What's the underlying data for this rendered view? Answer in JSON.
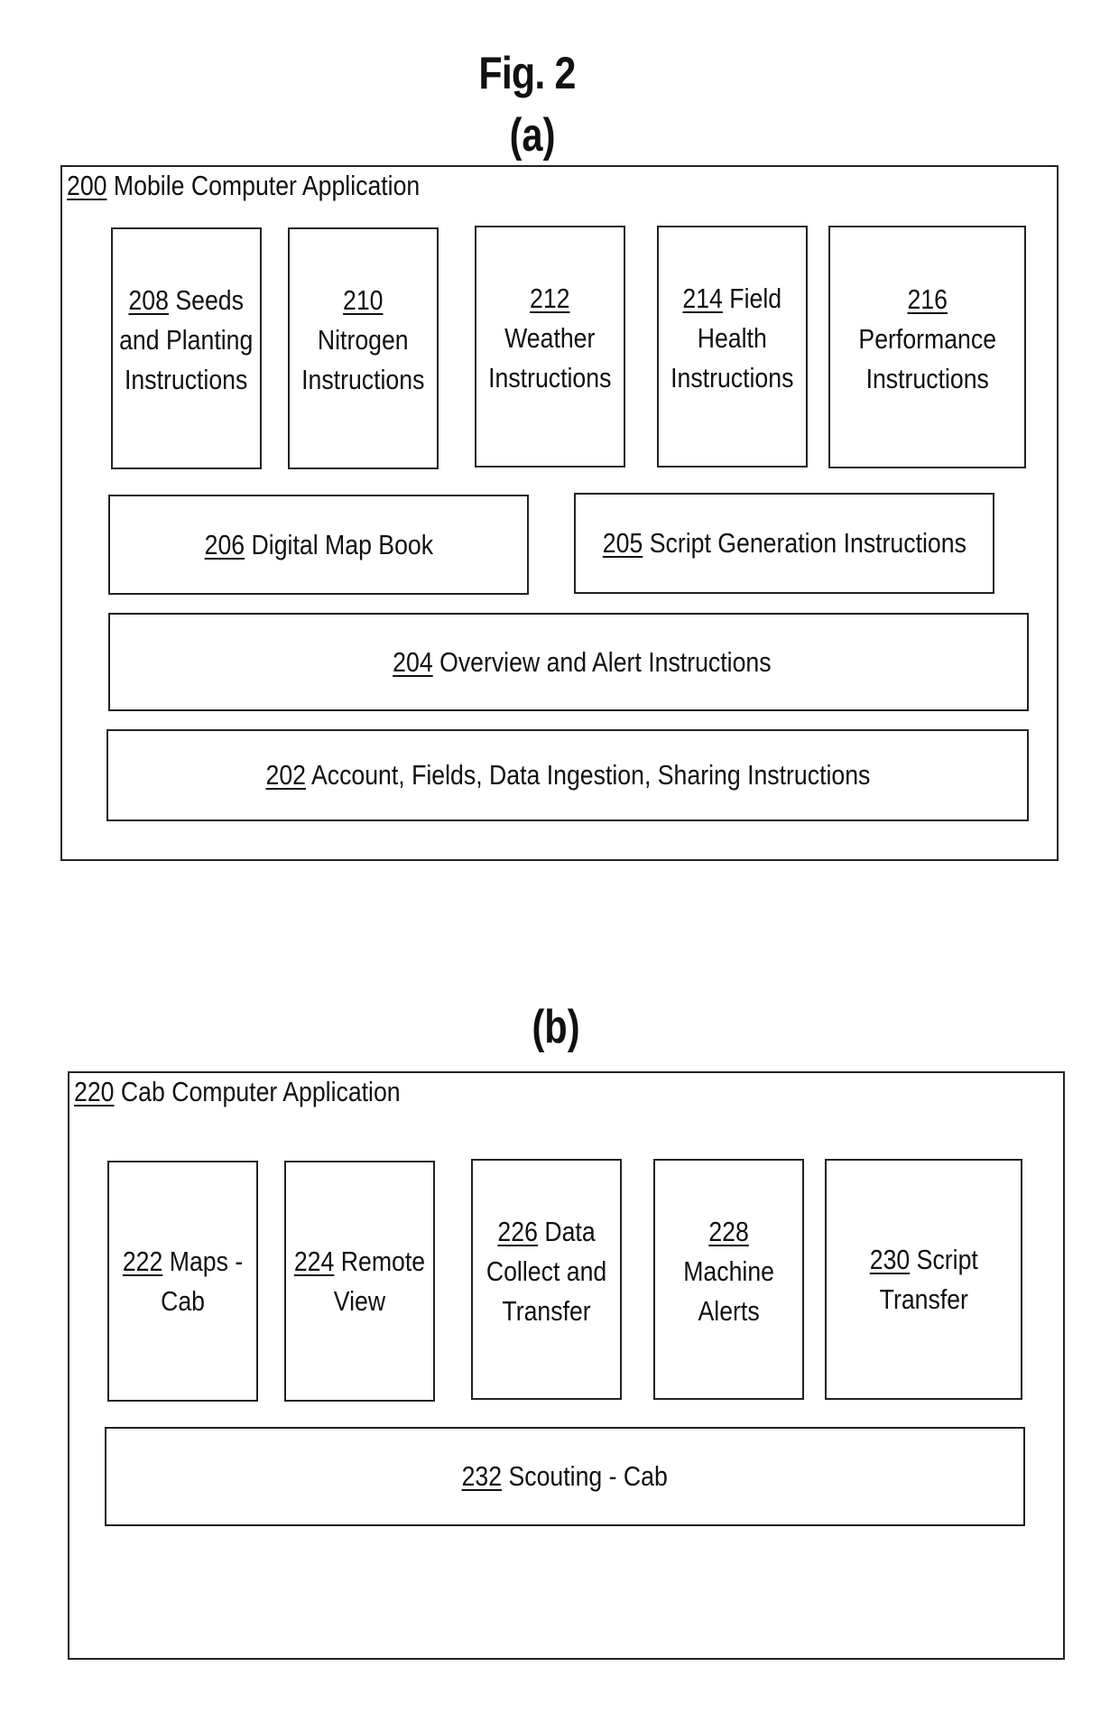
{
  "figure": {
    "title": "Fig. 2"
  },
  "panel_a": {
    "label": "(a)",
    "container": {
      "ref": "200",
      "title": "Mobile Computer Application"
    },
    "boxes": [
      {
        "ref": "208",
        "lines": [
          "Seeds",
          "and Planting",
          "Instructions"
        ]
      },
      {
        "ref": "210",
        "lines": [
          "",
          "Nitrogen",
          "Instructions"
        ]
      },
      {
        "ref": "212",
        "lines": [
          "",
          "Weather",
          "Instructions"
        ]
      },
      {
        "ref": "214",
        "lines": [
          "Field",
          "Health",
          "Instructions"
        ]
      },
      {
        "ref": "216",
        "lines": [
          "",
          "Performance",
          "Instructions"
        ]
      },
      {
        "ref": "206",
        "text": "Digital Map Book"
      },
      {
        "ref": "205",
        "text": "Script Generation Instructions"
      },
      {
        "ref": "204",
        "text": " Overview and Alert Instructions"
      },
      {
        "ref": "202",
        "text": "Account, Fields, Data Ingestion, Sharing Instructions"
      }
    ]
  },
  "panel_b": {
    "label": "(b)",
    "container": {
      "ref": "220",
      "title": "Cab Computer Application"
    },
    "boxes": [
      {
        "ref": "222",
        "lines": [
          "Maps -",
          "Cab"
        ]
      },
      {
        "ref": "224",
        "lines": [
          "Remote",
          "View"
        ]
      },
      {
        "ref": "226",
        "lines": [
          "Data",
          "Collect and",
          "Transfer"
        ]
      },
      {
        "ref": "228",
        "lines": [
          "",
          "Machine",
          "Alerts"
        ]
      },
      {
        "ref": "230",
        "lines": [
          "Script",
          "Transfer"
        ]
      },
      {
        "ref": "232",
        "text": "Scouting - Cab"
      }
    ]
  }
}
